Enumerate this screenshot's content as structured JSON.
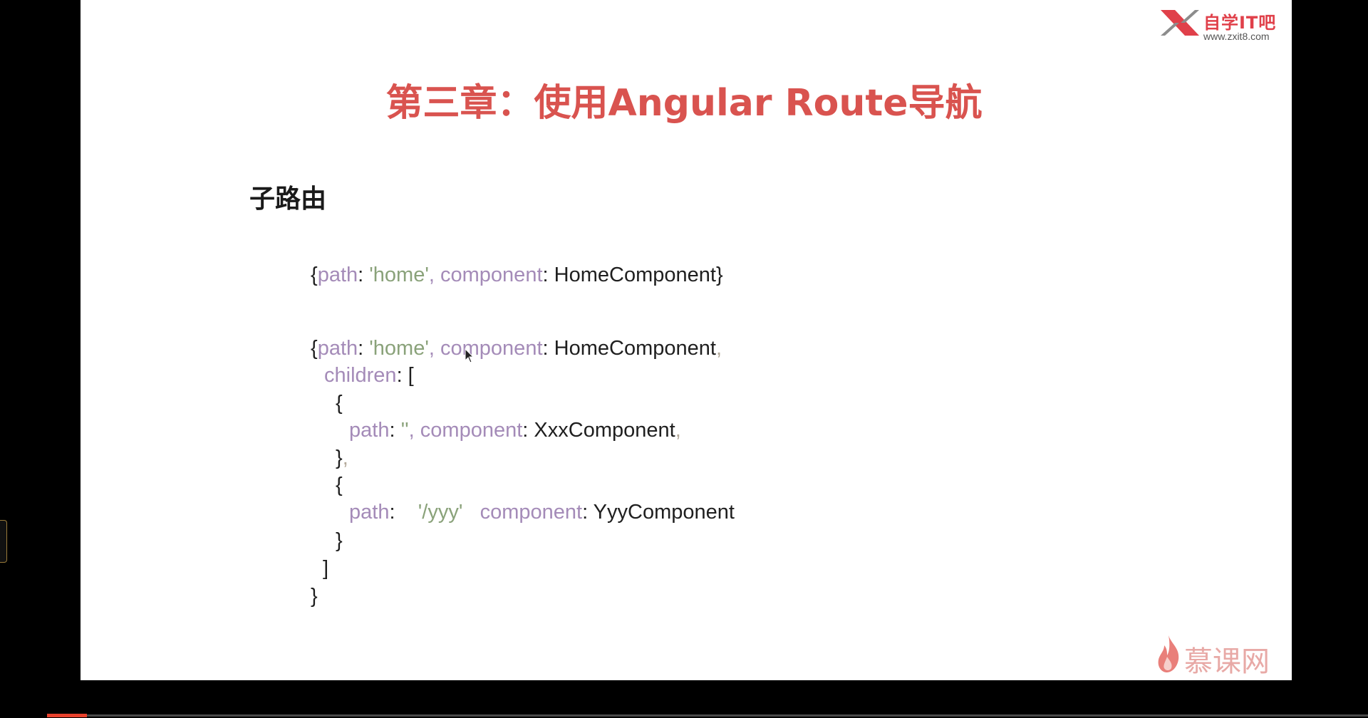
{
  "watermark_top": {
    "brand": "自学IT吧",
    "url": "www.zxit8.com",
    "icon": "x-logo-icon"
  },
  "slide": {
    "title": "第三章：使用Angular Route导航",
    "heading": "子路由",
    "code1": {
      "open": "{",
      "k_path": "path",
      "colon1": ": ",
      "s_home": "'home'",
      "comma1": ", ",
      "k_component": "component",
      "colon2": ": ",
      "value": "HomeComponent",
      "close": "}"
    },
    "code2": {
      "line1": {
        "open": "{",
        "k_path": "path",
        "colon1": ": ",
        "s_home": "'home'",
        "comma1": ", ",
        "k_component": "component",
        "colon2": ": ",
        "value": "HomeComponent",
        "comma2": ","
      },
      "line2": {
        "k_children": "children",
        "rest": ": ["
      },
      "line3": {
        "brace": "{"
      },
      "line4": {
        "k_path": "path",
        "colon1": ": ",
        "s_empty": "''",
        "comma1": ", ",
        "k_component": "component",
        "colon2": ": ",
        "value": "XxxComponent",
        "comma2": ","
      },
      "line5": {
        "brace": "}",
        "comma": ","
      },
      "line6": {
        "brace": "{"
      },
      "line7": {
        "k_path": "path",
        "colon1": ":    ",
        "s_yyy": "'/yyy'",
        "gap": "   ",
        "k_component": "component",
        "colon2": ": ",
        "value": "YyyComponent"
      },
      "line8": {
        "brace": "}"
      },
      "line9": {
        "bracket": "]"
      },
      "line10": {
        "brace": "}"
      }
    }
  },
  "watermark_bottom": {
    "text": "慕课网",
    "icon": "flame-icon"
  },
  "cursor": {
    "icon": "mouse-pointer-icon"
  },
  "video": {
    "progress_percent": 3
  },
  "colors": {
    "title": "#d9534f",
    "keyword": "#a48bb8",
    "string": "#8aa27a",
    "progress": "#e8412c"
  }
}
